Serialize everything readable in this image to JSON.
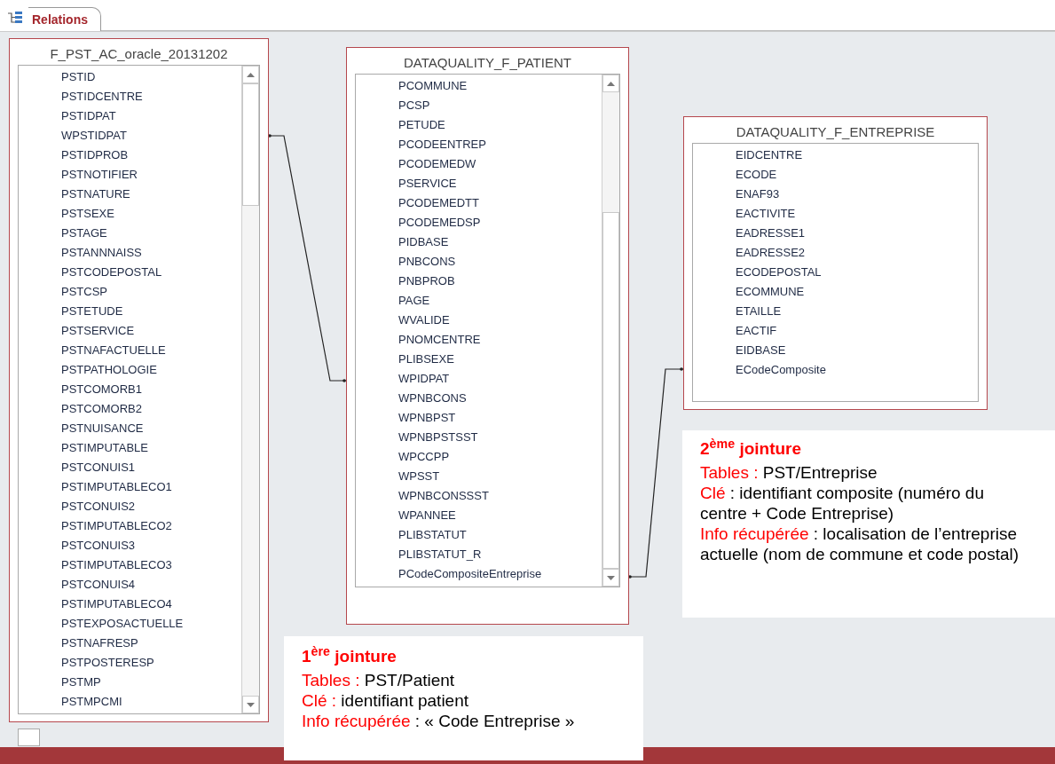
{
  "tab": {
    "label": "Relations",
    "selected": true
  },
  "tables": [
    {
      "title": "F_PST_AC_oracle_20131202",
      "fields": [
        "PSTID",
        "PSTIDCENTRE",
        "PSTIDPAT",
        "WPSTIDPAT",
        "PSTIDPROB",
        "PSTNOTIFIER",
        "PSTNATURE",
        "PSTSEXE",
        "PSTAGE",
        "PSTANNNAISS",
        "PSTCODEPOSTAL",
        "PSTCSP",
        "PSTETUDE",
        "PSTSERVICE",
        "PSTNAFACTUELLE",
        "PSTPATHOLOGIE",
        "PSTCOMORB1",
        "PSTCOMORB2",
        "PSTNUISANCE",
        "PSTIMPUTABLE",
        "PSTCONUIS1",
        "PSTIMPUTABLECO1",
        "PSTCONUIS2",
        "PSTIMPUTABLECO2",
        "PSTCONUIS3",
        "PSTIMPUTABLECO3",
        "PSTCONUIS4",
        "PSTIMPUTABLECO4",
        "PSTEXPOSACTUELLE",
        "PSTNAFRESP",
        "PSTPOSTERESP",
        "PSTMP",
        "PSTMPCMI"
      ]
    },
    {
      "title": "DATAQUALITY_F_PATIENT",
      "fields": [
        "PCOMMUNE",
        "PCSP",
        "PETUDE",
        "PCODEENTREP",
        "PCODEMEDW",
        "PSERVICE",
        "PCODEMEDTT",
        "PCODEMEDSP",
        "PIDBASE",
        "PNBCONS",
        "PNBPROB",
        "PAGE",
        "WVALIDE",
        "PNOMCENTRE",
        "PLIBSEXE",
        "WPIDPAT",
        "WPNBCONS",
        "WPNBPST",
        "WPNBPSTSST",
        "WPCCPP",
        "WPSST",
        "WPNBCONSSST",
        "WPANNEE",
        "PLIBSTATUT",
        "PLIBSTATUT_R",
        "PCodeCompositeEntreprise"
      ]
    },
    {
      "title": "DATAQUALITY_F_ENTREPRISE",
      "fields": [
        "EIDCENTRE",
        "ECODE",
        "ENAF93",
        "EACTIVITE",
        "EADRESSE1",
        "EADRESSE2",
        "ECODEPOSTAL",
        "ECOMMUNE",
        "ETAILLE",
        "EACTIF",
        "EIDBASE",
        "ECodeComposite"
      ]
    }
  ],
  "annotations": [
    {
      "heading": "2$^{ème}$ jointure",
      "lines": [
        {
          "label": "Tables :",
          "text": "PST/Entreprise"
        },
        {
          "label": "Clé",
          "text": ": identifiant composite (numéro du centre + Code Entreprise)"
        },
        {
          "label": "Info récupérée",
          "text": ": localisation de l’entreprise actuelle (nom de commune et code postal)"
        }
      ]
    },
    {
      "heading": "1$^{ère}$ jointure",
      "lines": [
        {
          "label": "Tables :",
          "text": "PST/Patient"
        },
        {
          "label": "Clé :",
          "text": "identifiant patient"
        },
        {
          "label": "Info récupérée",
          "text": ": « Code Entreprise »"
        }
      ]
    }
  ]
}
